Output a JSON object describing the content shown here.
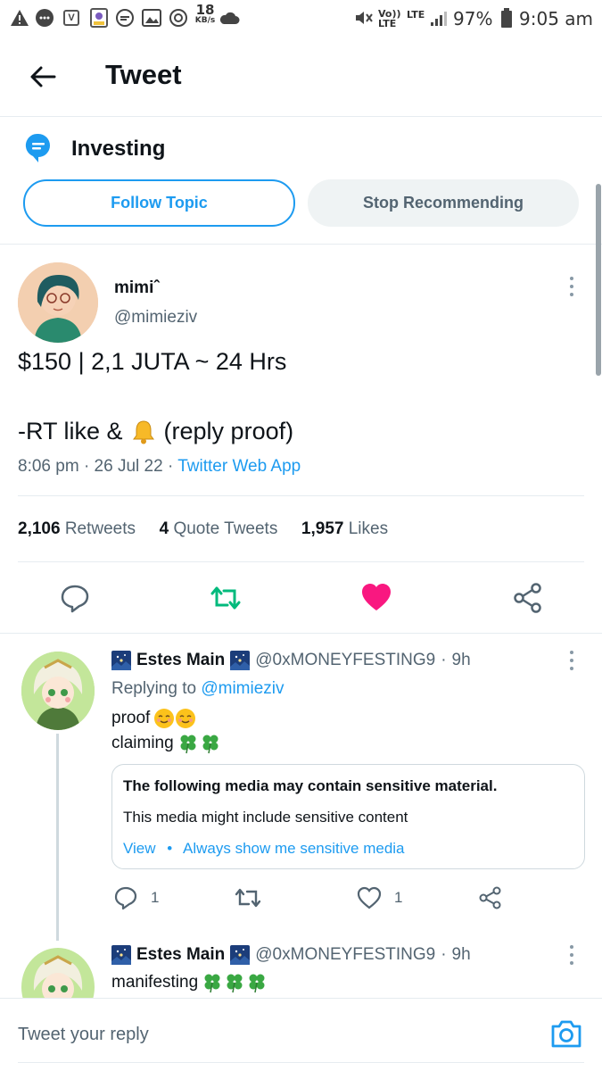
{
  "status_bar": {
    "speed_value": "18",
    "speed_unit": "KB/s",
    "volte": "Vo)) LTE",
    "lte": "LTE",
    "battery": "97%",
    "time": "9:05 am"
  },
  "header": {
    "title": "Tweet"
  },
  "topic": {
    "name": "Investing",
    "follow_label": "Follow Topic",
    "stop_label": "Stop Recommending"
  },
  "tweet": {
    "display_name": "mimiˆ",
    "handle": "@mimieziv",
    "text_line1": "$150 | 2,1 JUTA ~ 24 Hrs",
    "text_line2_a": "-RT like &",
    "text_line2_b": "(reply proof)",
    "time": "8:06 pm",
    "date": "26 Jul 22",
    "source": "Twitter Web App",
    "retweets_count": "2,106",
    "retweets_label": "Retweets",
    "quotes_count": "4",
    "quotes_label": "Quote Tweets",
    "likes_count": "1,957",
    "likes_label": "Likes"
  },
  "replies": [
    {
      "display_name": "Estes Main",
      "handle": "@0xMONEYFESTING9",
      "age": "9h",
      "replying_prefix": "Replying to",
      "replying_handle": "@mimieziv",
      "line1": "proof",
      "line2": "claiming",
      "sensitive_title": "The following media may contain sensitive material.",
      "sensitive_body": "This media might include sensitive content",
      "sensitive_view": "View",
      "sensitive_always": "Always show me sensitive media",
      "reply_count": "1",
      "like_count": "1"
    },
    {
      "display_name": "Estes Main",
      "handle": "@0xMONEYFESTING9",
      "age": "9h",
      "line1": "manifesting"
    }
  ],
  "composer": {
    "placeholder": "Tweet your reply"
  },
  "colors": {
    "accent": "#1d9bf0",
    "retweet": "#00ba7c",
    "like": "#f91880"
  }
}
